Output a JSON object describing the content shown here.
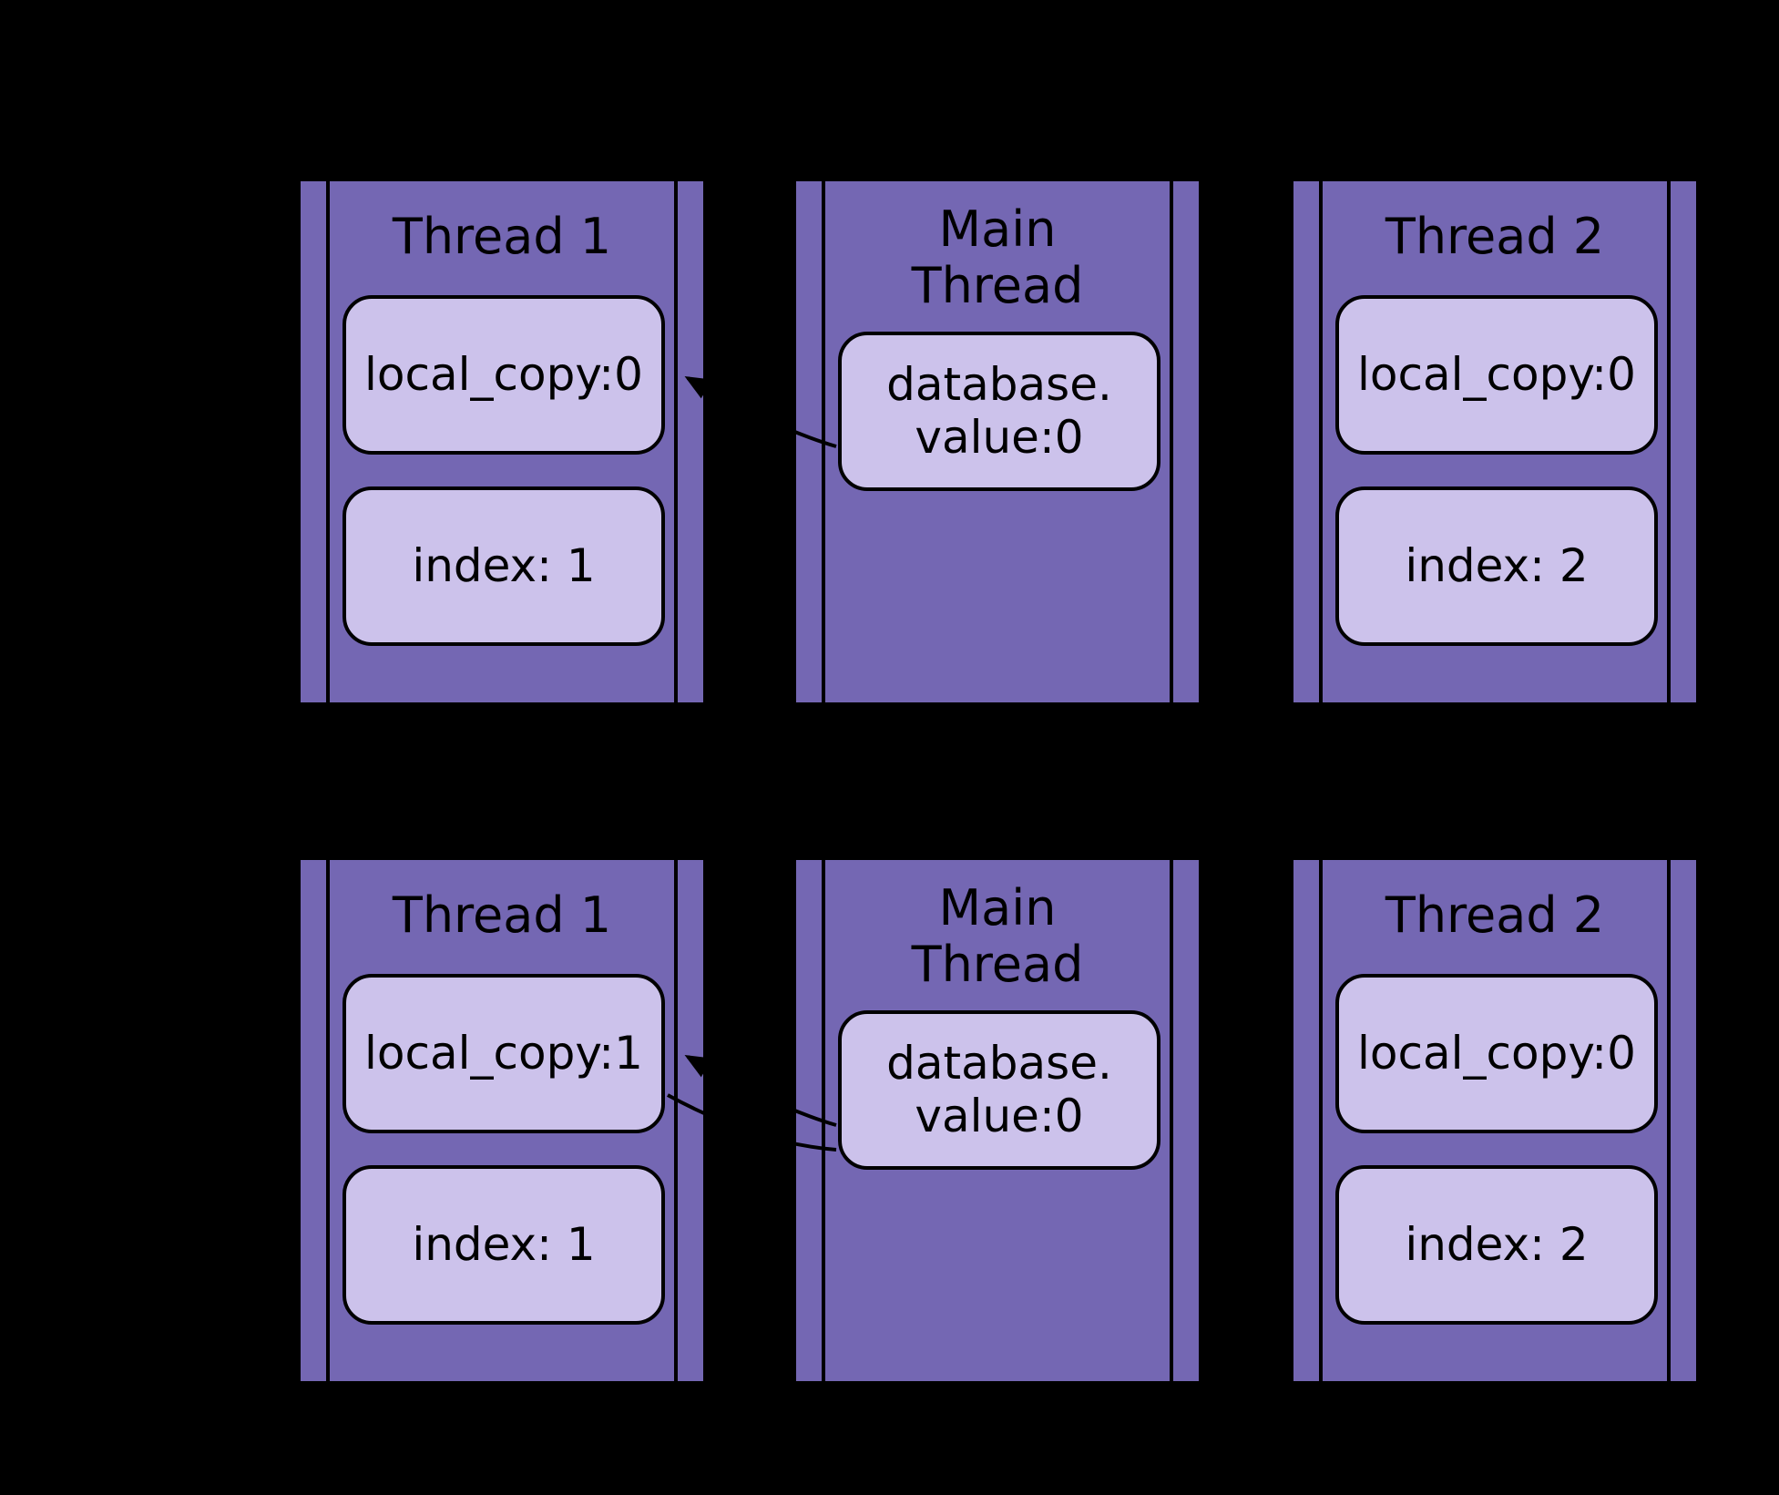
{
  "rows": [
    {
      "thread1": {
        "title": "Thread 1",
        "local_copy": "local_copy:0",
        "index": "index: 1"
      },
      "main": {
        "title": "Main Thread",
        "db": "database.\nvalue:0"
      },
      "thread2": {
        "title": "Thread 2",
        "local_copy": "local_copy:0",
        "index": "index: 2"
      }
    },
    {
      "thread1": {
        "title": "Thread 1",
        "local_copy": "local_copy:1",
        "index": "index: 1"
      },
      "main": {
        "title": "Main Thread",
        "db": "database.\nvalue:0"
      },
      "thread2": {
        "title": "Thread 2",
        "local_copy": "local_copy:0",
        "index": "index: 2"
      }
    }
  ]
}
